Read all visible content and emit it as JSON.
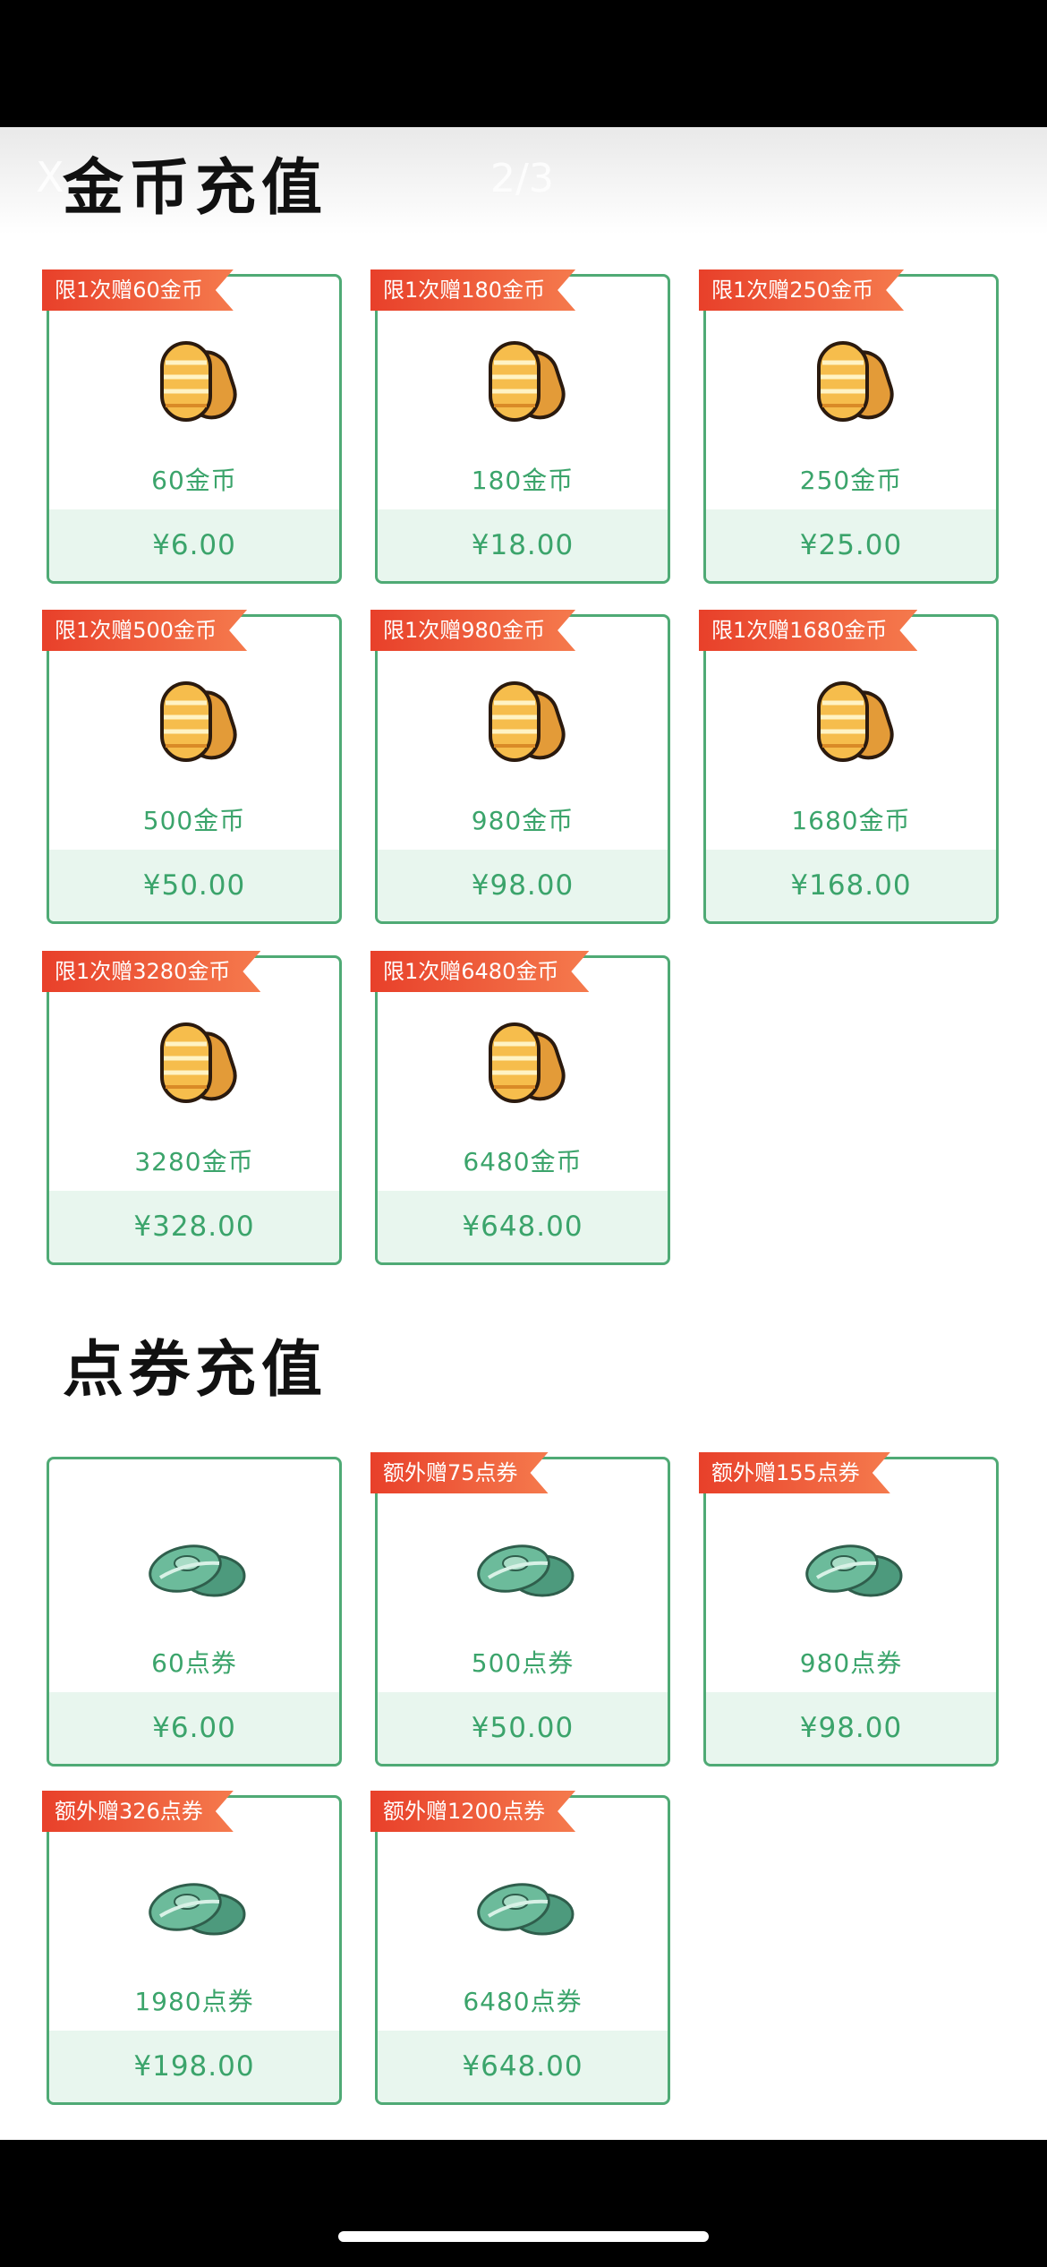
{
  "overlay": {
    "close_symbol": "X",
    "counter": "2/3"
  },
  "coins_section": {
    "title": "金币充值",
    "icon": "gold-coin-icon",
    "items": [
      {
        "badge": "限1次赠60金币",
        "qty": "60金币",
        "price": "¥6.00"
      },
      {
        "badge": "限1次赠180金币",
        "qty": "180金币",
        "price": "¥18.00"
      },
      {
        "badge": "限1次赠250金币",
        "qty": "250金币",
        "price": "¥25.00"
      },
      {
        "badge": "限1次赠500金币",
        "qty": "500金币",
        "price": "¥50.00"
      },
      {
        "badge": "限1次赠980金币",
        "qty": "980金币",
        "price": "¥98.00"
      },
      {
        "badge": "限1次赠1680金币",
        "qty": "1680金币",
        "price": "¥168.00"
      },
      {
        "badge": "限1次赠3280金币",
        "qty": "3280金币",
        "price": "¥328.00"
      },
      {
        "badge": "限1次赠6480金币",
        "qty": "6480金币",
        "price": "¥648.00"
      }
    ]
  },
  "vouchers_section": {
    "title": "点券充值",
    "icon": "jade-voucher-icon",
    "items": [
      {
        "badge": "",
        "qty": "60点券",
        "price": "¥6.00"
      },
      {
        "badge": "额外赠75点券",
        "qty": "500点券",
        "price": "¥50.00"
      },
      {
        "badge": "额外赠155点券",
        "qty": "980点券",
        "price": "¥98.00"
      },
      {
        "badge": "额外赠326点券",
        "qty": "1980点券",
        "price": "¥198.00"
      },
      {
        "badge": "额外赠1200点券",
        "qty": "6480点券",
        "price": "¥648.00"
      }
    ]
  },
  "colors": {
    "accent_green": "#3ba46b",
    "ribbon_red": "#e8402a",
    "coin_gold": "#f0a13a",
    "jade_green": "#5aa88a"
  }
}
